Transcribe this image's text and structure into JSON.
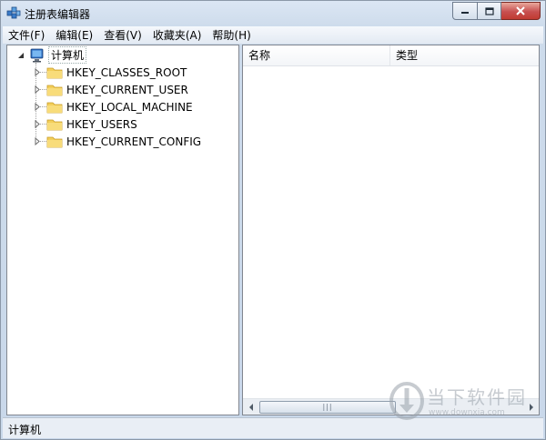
{
  "window": {
    "title": "注册表编辑器"
  },
  "menubar": {
    "items": [
      {
        "label": "文件(F)"
      },
      {
        "label": "编辑(E)"
      },
      {
        "label": "查看(V)"
      },
      {
        "label": "收藏夹(A)"
      },
      {
        "label": "帮助(H)"
      }
    ]
  },
  "tree": {
    "root": {
      "label": "计算机",
      "icon": "computer-icon"
    },
    "children": [
      {
        "label": "HKEY_CLASSES_ROOT",
        "icon": "folder-icon"
      },
      {
        "label": "HKEY_CURRENT_USER",
        "icon": "folder-icon"
      },
      {
        "label": "HKEY_LOCAL_MACHINE",
        "icon": "folder-icon"
      },
      {
        "label": "HKEY_USERS",
        "icon": "folder-icon"
      },
      {
        "label": "HKEY_CURRENT_CONFIG",
        "icon": "folder-icon"
      }
    ]
  },
  "list": {
    "columns": [
      {
        "label": "名称"
      },
      {
        "label": "类型"
      }
    ]
  },
  "statusbar": {
    "text": "计算机"
  },
  "watermark": {
    "main": "当下软件园",
    "sub": "www.downxia.com"
  },
  "colors": {
    "folder": "#f3cf5b",
    "close_button": "#c75050",
    "chrome": "#cddbeb"
  }
}
